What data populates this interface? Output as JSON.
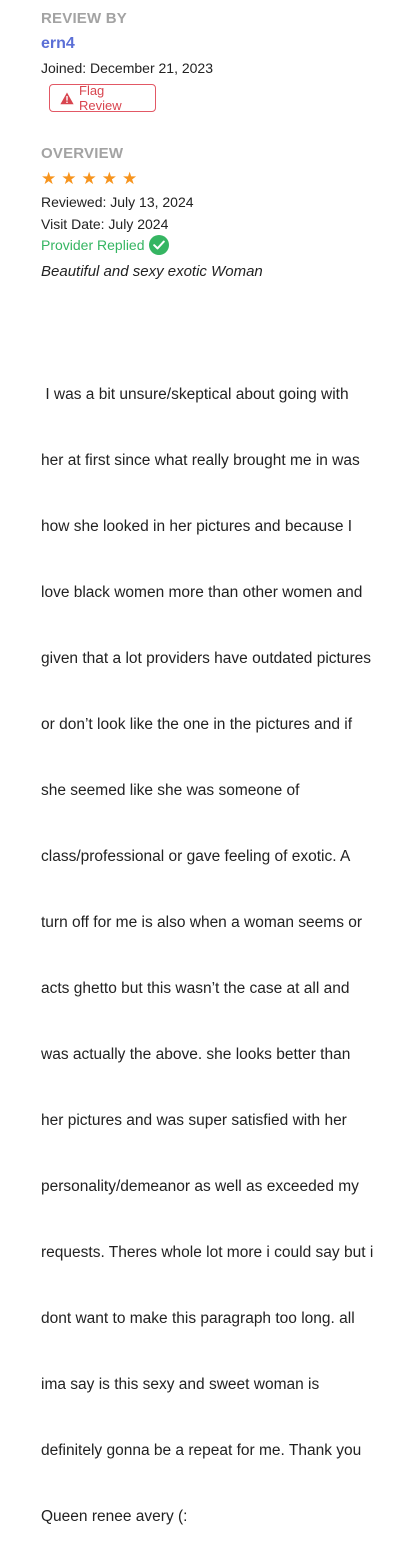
{
  "reviewer": {
    "section_label": "REVIEW BY",
    "username": "ern4",
    "joined": "Joined: December 21, 2023",
    "flag_label": "Flag Review",
    "flag_icon": "warning-triangle-icon",
    "flag_color": "#d8454f"
  },
  "overview": {
    "section_label": "OVERVIEW",
    "rating": 5,
    "star_color": "#f7941d",
    "reviewed": "Reviewed: July 13, 2024",
    "visit_date": "Visit Date: July 2024",
    "provider_replied": "Provider Replied",
    "provider_replied_color": "#35b562",
    "title": "Beautiful and sexy exotic Woman"
  },
  "review": {
    "lines": [
      " I was a bit unsure/skeptical about going with",
      "her at first since what really brought me in was",
      "how she looked in her pictures and because I",
      "love black women more than other women and",
      "given that a lot providers have outdated pictures",
      "or don’t look like the one in the pictures and if",
      "she seemed like she was someone of",
      "class/professional or gave feeling of exotic. A",
      "turn off for me is also when a woman seems or",
      "acts ghetto but this wasn’t the case at all and",
      "was actually the above. she looks better than",
      "her pictures and was super satisfied with her",
      "personality/demeanor as well as exceeded my",
      "requests. Theres whole lot more i could say but i",
      "dont want to make this paragraph too long. all",
      "ima say is this sexy and sweet woman is",
      "definitely gonna be a repeat for me. Thank you",
      "Queen renee avery (:"
    ]
  }
}
